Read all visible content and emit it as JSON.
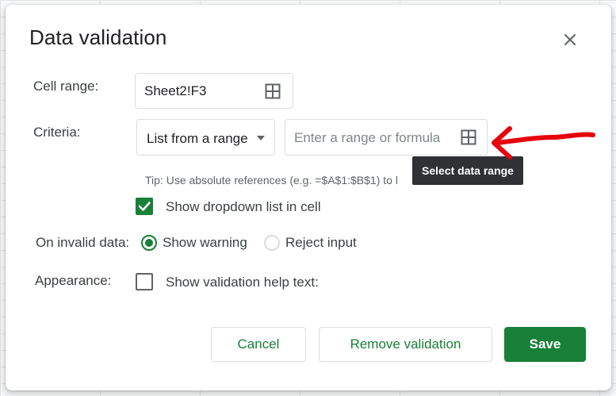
{
  "dialog": {
    "title": "Data validation",
    "close_icon": "close-icon"
  },
  "cell_range": {
    "label": "Cell range:",
    "value": "Sheet2!F3",
    "icon": "grid-select-icon"
  },
  "criteria": {
    "label": "Criteria:",
    "type_value": "List from a range",
    "dropdown_icon": "caret-down-icon",
    "range_placeholder": "Enter a range or formula",
    "range_icon": "grid-select-icon",
    "tip": "Tip: Use absolute references (e.g. =$A$1:$B$1) to l",
    "tooltip": "Select data range",
    "show_dropdown": {
      "label": "Show dropdown list in cell",
      "checked": true
    }
  },
  "invalid_data": {
    "label": "On invalid data:",
    "options": [
      {
        "label": "Show warning",
        "selected": true
      },
      {
        "label": "Reject input",
        "selected": false
      }
    ]
  },
  "appearance": {
    "label": "Appearance:",
    "help_text": {
      "label": "Show validation help text:",
      "checked": false
    }
  },
  "buttons": {
    "cancel": "Cancel",
    "remove": "Remove validation",
    "save": "Save"
  },
  "colors": {
    "accent": "#188038",
    "annotation_arrow": "#e8000b"
  }
}
